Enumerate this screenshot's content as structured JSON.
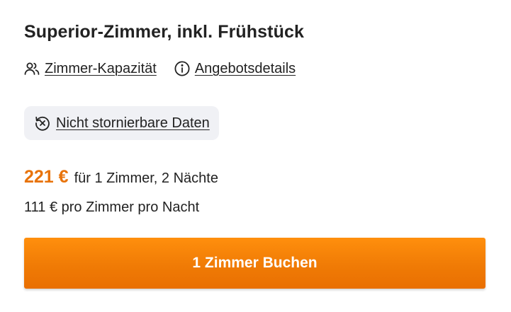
{
  "room": {
    "title": "Superior-Zimmer, inkl. Frühstück"
  },
  "links": {
    "capacity_label": "Zimmer-Kapazität",
    "capacity_icon": "people-icon",
    "offer_details_label": "Angebotsdetails",
    "offer_details_icon": "info-icon"
  },
  "policy": {
    "label": "Nicht stornierbare Daten",
    "icon": "non-refundable-clock-icon"
  },
  "pricing": {
    "total_price": "221 €",
    "total_note": "für 1 Zimmer, 2 Nächte",
    "per_night": "111 € pro Zimmer pro Nacht"
  },
  "booking": {
    "button_label": "1 Zimmer Buchen"
  },
  "colors": {
    "accent_price": "#e8730a",
    "button_bg": "#f07b05",
    "chip_bg": "#f0f1f5",
    "text": "#222222"
  }
}
